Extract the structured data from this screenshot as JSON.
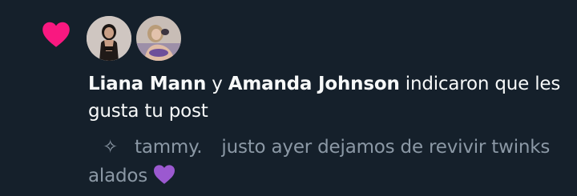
{
  "notification": {
    "type_icon": "heart-icon",
    "accent_color": "#f91880",
    "avatars": [
      {
        "icon": "avatar-liana-mann"
      },
      {
        "icon": "avatar-amanda-johnson"
      }
    ],
    "user1": "Liana Mann",
    "connector": "y",
    "user2": "Amanda Johnson",
    "action": "indicaron que les gusta tu post",
    "preview": {
      "icon": "sparkle-icon",
      "glyph": "✧",
      "author": "tammy.",
      "text": "justo ayer dejamos de revivir twinks alados",
      "emoji_icon": "purple-heart-icon",
      "emoji_color": "#9b59d0"
    }
  }
}
